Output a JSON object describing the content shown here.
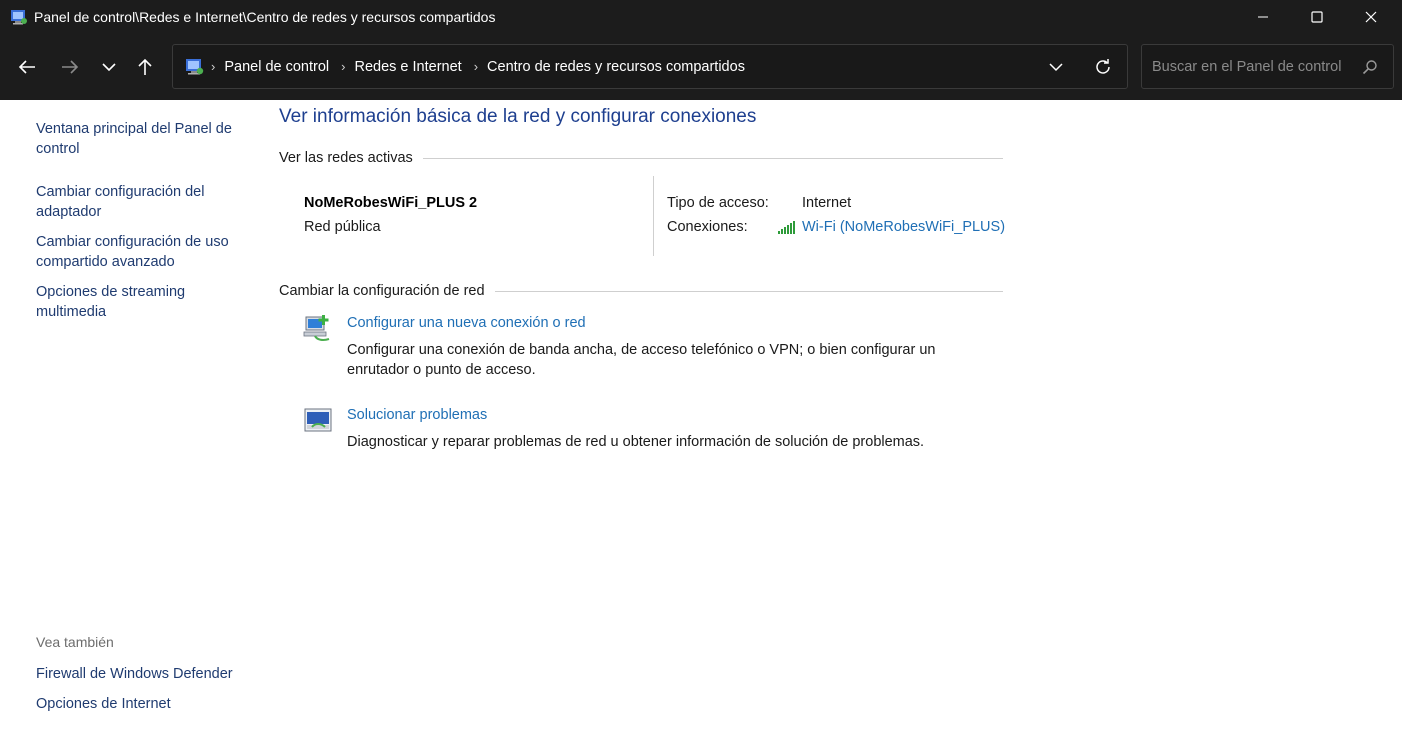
{
  "window": {
    "title": "Panel de control\\Redes e Internet\\Centro de redes y recursos compartidos",
    "icon": "control-panel-icon"
  },
  "address_bar": {
    "breadcrumbs": [
      "Panel de control",
      "Redes e Internet",
      "Centro de redes y recursos compartidos"
    ],
    "separator": "›"
  },
  "search": {
    "placeholder": "Buscar en el Panel de control",
    "value": ""
  },
  "left_pane": {
    "links": [
      "Ventana principal del Panel de control",
      "Cambiar configuración del adaptador",
      "Cambiar configuración de uso compartido avanzado",
      "Opciones de streaming multimedia"
    ],
    "see_also_heading": "Vea también",
    "see_also_links": [
      "Firewall de Windows Defender",
      "Opciones de Internet"
    ]
  },
  "main": {
    "title": "Ver información básica de la red y configurar conexiones",
    "active_networks_heading": "Ver las redes activas",
    "network": {
      "name": "NoMeRobesWiFi_PLUS 2",
      "category": "Red pública",
      "access_type_label": "Tipo de acceso:",
      "access_type_value": "Internet",
      "connections_label": "Conexiones:",
      "connection_link": "Wi-Fi (NoMeRobesWiFi_PLUS)"
    },
    "change_settings_heading": "Cambiar la configuración de red",
    "tasks": [
      {
        "icon": "new-connection-icon",
        "link": "Configurar una nueva conexión o red",
        "description": "Configurar una conexión de banda ancha, de acceso telefónico o VPN; o bien configurar un enrutador o punto de acceso."
      },
      {
        "icon": "troubleshoot-icon",
        "link": "Solucionar problemas",
        "description": "Diagnosticar y reparar problemas de red u obtener información de solución de problemas."
      }
    ]
  },
  "colors": {
    "titlebar_bg": "#1c1c1c",
    "link_blue": "#1f6fb5",
    "title_blue": "#1e3f8f",
    "nav_link": "#1f3b70",
    "signal_green": "#2e9b3a"
  }
}
